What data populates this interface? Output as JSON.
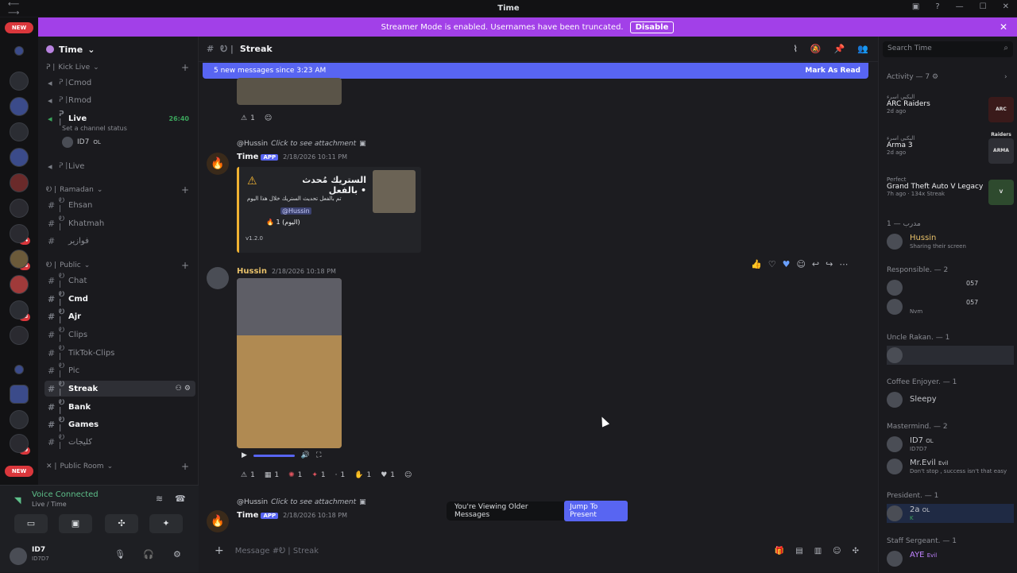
{
  "window": {
    "title": "Time"
  },
  "banner": {
    "text": "Streamer Mode is enabled. Usernames have been truncated.",
    "button": "Disable"
  },
  "guild_badges": {
    "new_top": "NEW",
    "new_bottom": "NEW",
    "b1": "84",
    "b2": "26",
    "b3": "38",
    "b4": "29"
  },
  "server": {
    "name": "Time"
  },
  "categories": {
    "kick": "Kick Live",
    "ramadan": "Ramadan",
    "public": "Public",
    "public_room": "Public Room"
  },
  "channels": {
    "cmod": "Cmod",
    "rmod": "Rmod",
    "live": "Live",
    "live_time": "26:40",
    "set_status": "Set a channel status",
    "voice_user": "ID7",
    "voice_user_tag": "OL",
    "live2": "Live",
    "ehsan": "Ehsan",
    "khatmah": "Khatmah",
    "fawazeer": "فوازير",
    "chat": "Chat",
    "cmd": "Cmd",
    "ajr": "Ajr",
    "clips": "Clips",
    "tiktok": "TikTok-Clips",
    "pic": "Pic",
    "streak": "Streak",
    "bank": "Bank",
    "games": "Games",
    "kaleejat": "كليجات"
  },
  "voice": {
    "title": "Voice Connected",
    "sub": "Live / Time"
  },
  "user": {
    "name": "ID7",
    "tag": "ID7D7"
  },
  "header": {
    "channel": "Streak"
  },
  "newbar": {
    "text": "5 new messages since 3:23 AM",
    "mark": "Mark As Read"
  },
  "messages": {
    "ref1_user": "@Hussin",
    "ref1_text": "Click to see attachment",
    "bot_name": "Time",
    "app_tag": "APP",
    "time1": "2/18/2026 10:11 PM",
    "embed_title": "الستريك مُحدث بالفعل •",
    "embed_line1": "تم بالفعل تحديث الستريك خلال هذا اليوم",
    "embed_mention": "@Hussin",
    "embed_streak": "1 (اليوم)",
    "embed_footer": "v1.2.0",
    "author2": "Hussin",
    "time2": "2/18/2026 10:18 PM",
    "ref2_user": "@Hussin",
    "ref2_text": "Click to see attachment",
    "time3": "2/18/2026 10:18 PM",
    "r_top": "1",
    "r1": "1",
    "r2": "1",
    "r3": "1",
    "r4": "1",
    "r5": "1",
    "r6": "1",
    "r7": "1"
  },
  "older": {
    "text": "You're Viewing Older Messages",
    "jump": "Jump To Present"
  },
  "composer": {
    "placeholder": "Message #Ꭷ | Streak"
  },
  "right": {
    "search_placeholder": "Search Time",
    "activity": "Activity — 7",
    "acts": [
      {
        "who": "البكبي اسرء",
        "game": "ARC Raiders",
        "ago": "2d ago",
        "art": "ARC Raiders"
      },
      {
        "who": "البكبي اسرء",
        "game": "Arma 3",
        "ago": "2d ago",
        "art": "ARMA"
      },
      {
        "who": "Perfect",
        "game": "Grand Theft Auto V Legacy",
        "ago": "7h ago · 134x Streak",
        "art": "V"
      }
    ],
    "g1": "مدرب — 1",
    "m1": "Hussin",
    "m1s": "Sharing their screen",
    "g2": "Responsible. — 2",
    "m2": "057",
    "m3": "057",
    "m3s": "Nvm",
    "g3": "Uncle Rakan. — 1",
    "g4": "Coffee Enjoyer. — 1",
    "m5": "Sleepy",
    "g5": "Mastermind. — 2",
    "m6": "ID7",
    "m6t": "OL",
    "m6s": "ID7D7",
    "m7": "Mr.Evil",
    "m7t": "Evil",
    "m7s": "Don't stop , success isn't that easy",
    "g6": "President. — 1",
    "m8": "2a",
    "m8t": "OL",
    "m8s": "K",
    "g7": "Staff Sergeant. — 1",
    "m9": "AYE",
    "m9t": "Evil"
  },
  "colors": {
    "accent": "#5865f2",
    "banner": "#a240e8",
    "online": "#3ba55c",
    "badge": "#da373c"
  }
}
